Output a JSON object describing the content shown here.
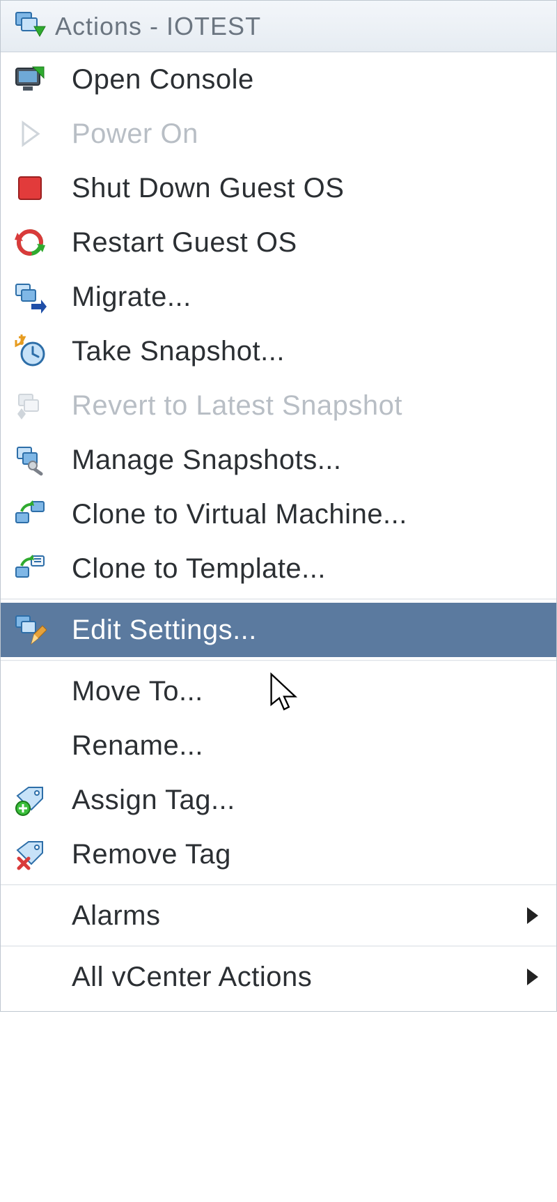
{
  "header": {
    "title": "Actions - IOTEST",
    "icon": "vm-actions-icon"
  },
  "items": [
    {
      "label": "Open Console",
      "icon": "console-icon",
      "enabled": true,
      "submenu": false
    },
    {
      "label": "Power On",
      "icon": "power-on-icon",
      "enabled": false,
      "submenu": false
    },
    {
      "label": "Shut Down Guest OS",
      "icon": "shutdown-icon",
      "enabled": true,
      "submenu": false
    },
    {
      "label": "Restart Guest OS",
      "icon": "restart-icon",
      "enabled": true,
      "submenu": false
    },
    {
      "label": "Migrate...",
      "icon": "migrate-icon",
      "enabled": true,
      "submenu": false
    },
    {
      "label": "Take Snapshot...",
      "icon": "snapshot-take-icon",
      "enabled": true,
      "submenu": false
    },
    {
      "label": "Revert to Latest Snapshot",
      "icon": "snapshot-revert-icon",
      "enabled": false,
      "submenu": false
    },
    {
      "label": "Manage Snapshots...",
      "icon": "snapshot-manage-icon",
      "enabled": true,
      "submenu": false
    },
    {
      "label": "Clone to Virtual Machine...",
      "icon": "clone-vm-icon",
      "enabled": true,
      "submenu": false
    },
    {
      "label": "Clone to Template...",
      "icon": "clone-template-icon",
      "enabled": true,
      "submenu": false
    },
    {
      "separator": true
    },
    {
      "label": "Edit Settings...",
      "icon": "edit-settings-icon",
      "enabled": true,
      "submenu": false,
      "selected": true
    },
    {
      "separator": true
    },
    {
      "label": "Move To...",
      "icon": "",
      "enabled": true,
      "submenu": false
    },
    {
      "label": "Rename...",
      "icon": "",
      "enabled": true,
      "submenu": false
    },
    {
      "label": "Assign Tag...",
      "icon": "assign-tag-icon",
      "enabled": true,
      "submenu": false
    },
    {
      "label": "Remove Tag",
      "icon": "remove-tag-icon",
      "enabled": true,
      "submenu": false
    },
    {
      "separator": true
    },
    {
      "label": "Alarms",
      "icon": "",
      "enabled": true,
      "submenu": true
    },
    {
      "separator": true
    },
    {
      "label": "All vCenter Actions",
      "icon": "",
      "enabled": true,
      "submenu": true
    }
  ],
  "colors": {
    "selected_bg": "#5b7a9f",
    "disabled_text": "#b8bec5",
    "text": "#2b2f33",
    "header_text": "#6b7580"
  }
}
